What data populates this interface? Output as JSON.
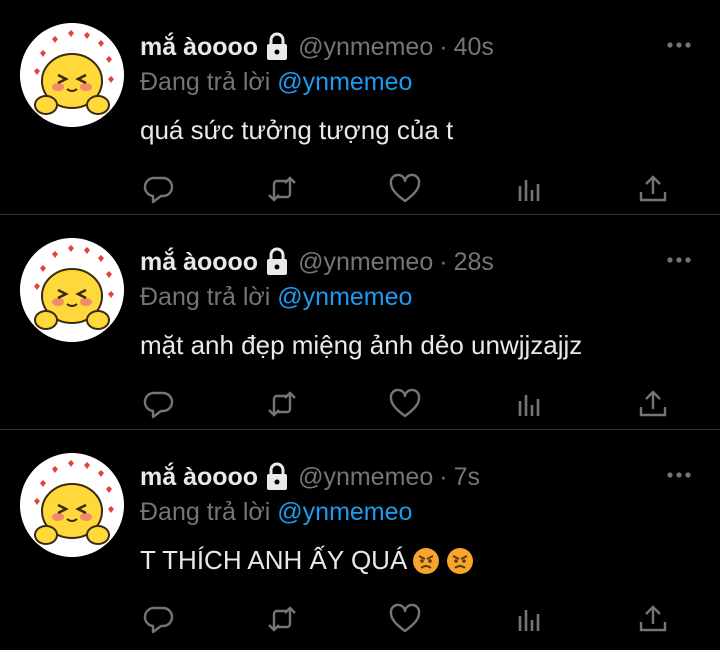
{
  "colors": {
    "background": "#000000",
    "text": "#e7e9ea",
    "muted": "#71767b",
    "mention": "#1d9bf0",
    "divider": "#2f3336"
  },
  "tweets": [
    {
      "display_name": "mắ àoooo",
      "handle": "@ynmemeo",
      "time": "40s",
      "reply_prefix": "Đang trả lời",
      "reply_to": "@ynmemeo",
      "text": "quá sức tưởng tượng của t",
      "emojis": []
    },
    {
      "display_name": "mắ àoooo",
      "handle": "@ynmemeo",
      "time": "28s",
      "reply_prefix": "Đang trả lời",
      "reply_to": "@ynmemeo",
      "text": "mặt anh đẹp miệng ảnh dẻo unwjjzajjz",
      "emojis": []
    },
    {
      "display_name": "mắ àoooo",
      "handle": "@ynmemeo",
      "time": "7s",
      "reply_prefix": "Đang trả lời",
      "reply_to": "@ynmemeo",
      "text": "T THÍCH ANH ẤY QUÁ",
      "emojis": [
        "angry-face-icon",
        "angry-face-icon"
      ]
    }
  ],
  "icons": {
    "lock": "lock-icon",
    "more": "more-dots-icon",
    "reply": "reply-icon",
    "retweet": "retweet-icon",
    "like": "heart-icon",
    "views": "views-icon",
    "share": "share-icon"
  },
  "dot": "·"
}
